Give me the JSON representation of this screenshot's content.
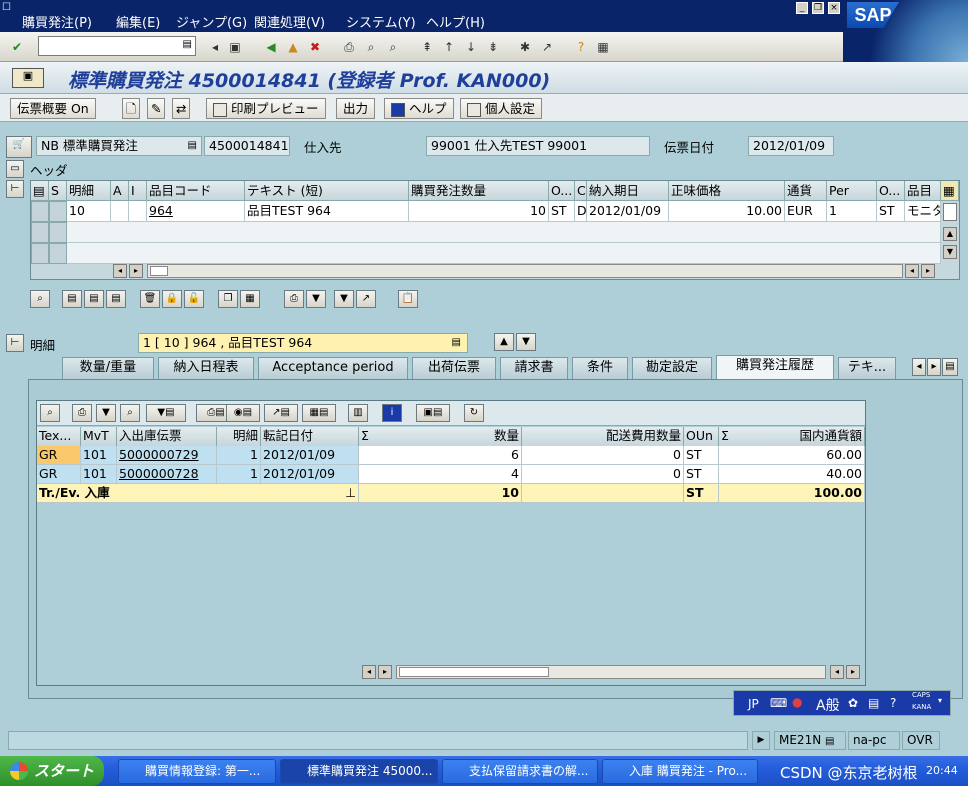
{
  "menu": [
    "購買発注(P)",
    "編集(E)",
    "ジャンプ(G)",
    "関連処理(V)",
    "システム(Y)",
    "ヘルプ(H)"
  ],
  "brand": "SAP",
  "title": "標準購買発注 4500014841 (登録者 Prof. KAN000)",
  "app_toolbar": {
    "overview": "伝票概要 On",
    "print_preview": "印刷プレビュー",
    "output": "出力",
    "help": "ヘルプ",
    "personal": "個人設定"
  },
  "header": {
    "doc_type": "NB 標準購買発注",
    "po_number": "4500014841",
    "vendor_label": "仕入先",
    "vendor_value": "99001 仕入先TEST 99001",
    "date_label": "伝票日付",
    "date_value": "2012/01/09",
    "section": "ヘッダ"
  },
  "items": {
    "columns": [
      "S",
      "明細",
      "A",
      "I",
      "品目コード",
      "テキスト (短)",
      "購買発注数量",
      "O...",
      "C",
      "納入期日",
      "正味価格",
      "通貨",
      "Per",
      "O...",
      "品目"
    ],
    "rows": [
      [
        "",
        "10",
        "",
        "",
        "964",
        "品目TEST 964",
        "10",
        "ST",
        "D",
        "2012/01/09",
        "10.00",
        "EUR",
        "1",
        "ST",
        "モニタ"
      ]
    ]
  },
  "detail": {
    "label": "明細",
    "selected": "1 [ 10 ] 964 , 品目TEST 964"
  },
  "tabs": [
    "数量/重量",
    "納入日程表",
    "Acceptance period",
    "出荷伝票",
    "請求書",
    "条件",
    "勘定設定",
    "購買発注履歴",
    "テキ..."
  ],
  "active_tab": "購買発注履歴",
  "history": {
    "columns": [
      "Tex...",
      "MvT",
      "入出庫伝票",
      "明細",
      "転記日付",
      "数量",
      "配送費用数量",
      "OUn",
      "国内通貨額"
    ],
    "rows": [
      [
        "GR",
        "101",
        "5000000729",
        "1",
        "2012/01/09",
        "6",
        "0",
        "ST",
        "60.00"
      ],
      [
        "GR",
        "101",
        "5000000728",
        "1",
        "2012/01/09",
        "4",
        "0",
        "ST",
        "40.00"
      ]
    ],
    "total": {
      "label": "Tr./Ev. 入庫",
      "qty": "10",
      "oun": "ST",
      "amount": "100.00"
    },
    "sigma": "Σ"
  },
  "ime": {
    "lang": "JP",
    "mode": "A般",
    "caps": "CAPS",
    "kana": "KANA"
  },
  "status": {
    "tcode": "ME21N",
    "server": "na-pc",
    "mode": "OVR"
  },
  "taskbar": {
    "start": "スタート",
    "tasks": [
      "購買情報登録: 第一...",
      "標準購買発注 45000...",
      "支払保留請求書の解...",
      "入庫 購買発注 - Pro..."
    ],
    "watermark": "CSDN @东京老树根",
    "clock": "20:44"
  }
}
